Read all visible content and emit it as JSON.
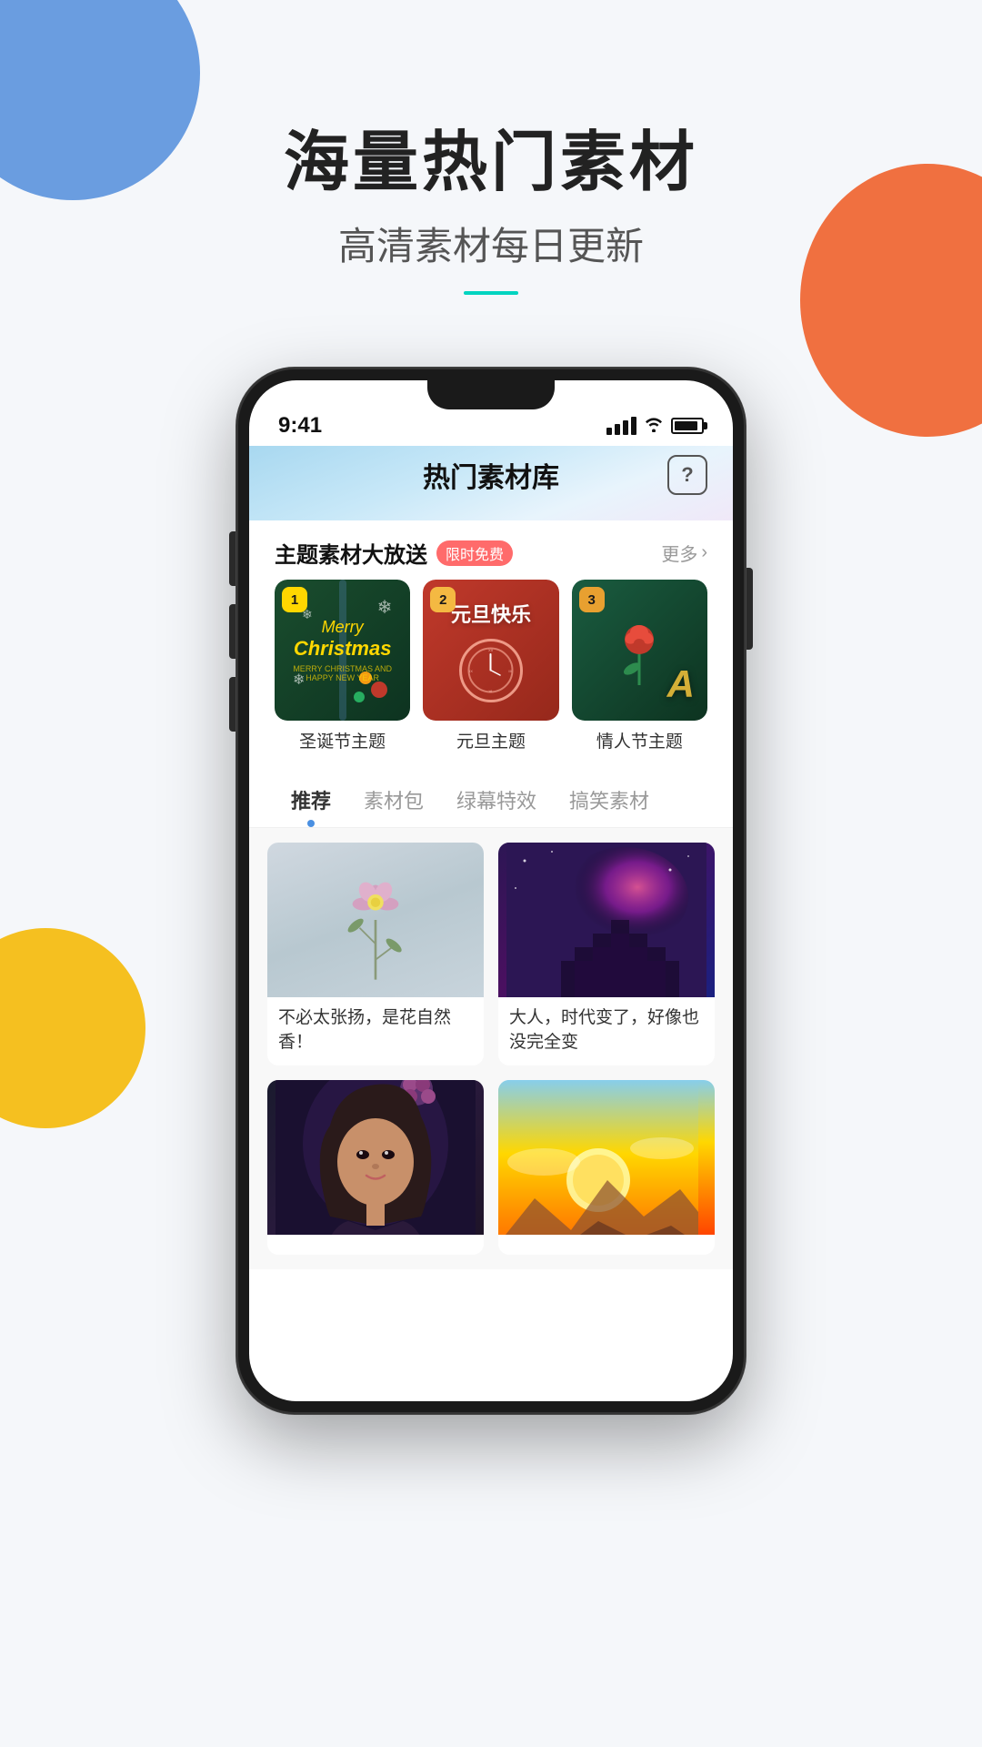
{
  "page": {
    "background_color": "#f5f7fa"
  },
  "decorations": {
    "blob_blue_color": "#6a9de0",
    "blob_orange_color": "#f07040",
    "blob_yellow_color": "#f5c020"
  },
  "header": {
    "main_title": "海量热门素材",
    "sub_title": "高清素材每日更新",
    "accent_color": "#00d4c0"
  },
  "phone": {
    "status_bar": {
      "time": "9:41",
      "signal": "signal",
      "wifi": "wifi",
      "battery": "battery"
    },
    "app_title": "热门素材库",
    "help_button_label": "?",
    "section": {
      "title": "主题素材大放送",
      "badge": "限时免费",
      "more": "更多"
    },
    "theme_cards": [
      {
        "rank": "1",
        "rank_class": "rank-1",
        "type": "christmas",
        "merry": "Merry",
        "christmas": "Christmas",
        "label": "圣诞节主题"
      },
      {
        "rank": "2",
        "rank_class": "rank-2",
        "type": "newyear",
        "text_line1": "元旦快乐",
        "label": "元旦主题"
      },
      {
        "rank": "3",
        "rank_class": "rank-3",
        "type": "valentine",
        "label": "情人节主题"
      }
    ],
    "tabs": [
      {
        "label": "推荐",
        "active": true
      },
      {
        "label": "素材包",
        "active": false
      },
      {
        "label": "绿幕特效",
        "active": false
      },
      {
        "label": "搞笑素材",
        "active": false
      }
    ],
    "content_cards": [
      {
        "type": "flower",
        "caption": "不必太张扬，是花自然香！"
      },
      {
        "type": "galaxy",
        "caption": "大人，时代变了，好像也没完全变"
      },
      {
        "type": "girl",
        "caption": ""
      },
      {
        "type": "sunset",
        "caption": ""
      }
    ]
  }
}
